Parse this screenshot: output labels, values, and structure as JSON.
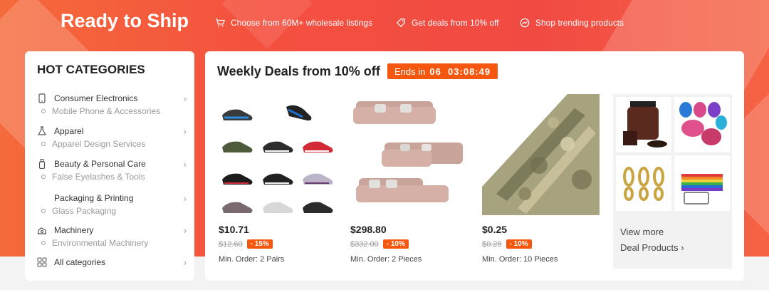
{
  "banner": {
    "title": "Ready to Ship",
    "features": [
      {
        "icon": "cart-icon",
        "label": "Choose from 60M+ wholesale listings"
      },
      {
        "icon": "tag-icon",
        "label": "Get deals from 10% off"
      },
      {
        "icon": "trending-icon",
        "label": "Shop trending products"
      }
    ]
  },
  "sidebar": {
    "heading": "HOT CATEGORIES",
    "categories": [
      {
        "icon": "phone-icon",
        "name": "Consumer Electronics",
        "sub": "Mobile Phone & Accessories"
      },
      {
        "icon": "flask-icon",
        "name": "Apparel",
        "sub": "Apparel Design Services"
      },
      {
        "icon": "bottle-icon",
        "name": "Beauty & Personal Care",
        "sub": "False Eyelashes & Tools"
      },
      {
        "icon": "",
        "name": "Packaging & Printing",
        "sub": "Glass Packaging"
      },
      {
        "icon": "machine-icon",
        "name": "Machinery",
        "sub": "Environmental Machinery"
      }
    ],
    "all_label": "All categories"
  },
  "deals": {
    "heading": "Weekly Deals from 10% off",
    "timer_label": "Ends in",
    "timer_value": "06  03:08:49",
    "products": [
      {
        "price": "$10.71",
        "old_price": "$12.60",
        "discount": "- 15%",
        "moq": "Min. Order: 2 Pairs"
      },
      {
        "price": "$298.80",
        "old_price": "$332.00",
        "discount": "- 10%",
        "moq": "Min. Order: 2 Pieces"
      },
      {
        "price": "$0.25",
        "old_price": "$0.28",
        "discount": "- 10%",
        "moq": "Min. Order: 10 Pieces"
      }
    ],
    "view_more": "View more",
    "deal_products": "Deal Products ›"
  },
  "colors": {
    "accent": "#f5570e",
    "banner": "#f14a43"
  }
}
